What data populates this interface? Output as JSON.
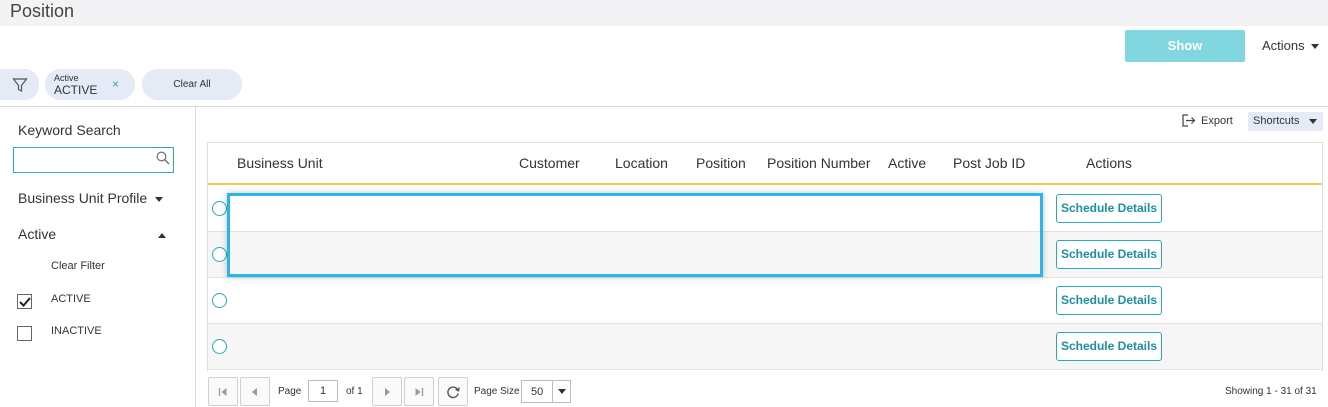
{
  "page": {
    "title": "Position"
  },
  "header": {
    "show_label": "Show",
    "actions_label": "Actions"
  },
  "filters": {
    "chip_label": "Active",
    "chip_value": "ACTIVE",
    "chip_remove": "×",
    "clear_all": "Clear All"
  },
  "sidebar": {
    "keyword_label": "Keyword Search",
    "keyword_value": "",
    "bu_profile_label": "Business Unit Profile",
    "active_label": "Active",
    "clear_filter": "Clear Filter",
    "options": [
      {
        "label": "ACTIVE",
        "checked": true
      },
      {
        "label": "INACTIVE",
        "checked": false
      }
    ]
  },
  "toolbar": {
    "export_label": "Export",
    "shortcuts_label": "Shortcuts"
  },
  "grid": {
    "columns": [
      "Business Unit",
      "Customer",
      "Location",
      "Position",
      "Position Number",
      "Active",
      "Post Job ID",
      "Actions"
    ],
    "rows": [
      {
        "bu": "",
        "customer": "",
        "location": "",
        "position": "",
        "number": "",
        "active": "",
        "job_id": "",
        "action": "Schedule Details"
      },
      {
        "bu": "",
        "customer": "",
        "location": "",
        "position": "",
        "number": "",
        "active": "",
        "job_id": "",
        "action": "Schedule Details"
      },
      {
        "bu": "",
        "customer": "",
        "location": "",
        "position": "",
        "number": "",
        "active": "",
        "job_id": "",
        "action": "Schedule Details"
      },
      {
        "bu": "",
        "customer": "",
        "location": "",
        "position": "",
        "number": "",
        "active": "",
        "job_id": "",
        "action": "Schedule Details"
      }
    ]
  },
  "pager": {
    "page_label": "Page",
    "page_value": "1",
    "of_label": "of 1",
    "page_size_label": "Page Size",
    "page_size_value": "50",
    "showing": "Showing 1 - 31 of 31"
  },
  "colors": {
    "accent": "#2aa7b8",
    "show_button": "#82d6e0",
    "header_underline": "#f5c94c",
    "highlight": "#29b6e6",
    "chip_bg": "#e4eaf6"
  },
  "icons": [
    "filter-icon",
    "close-icon",
    "search-icon",
    "chevron-down-icon",
    "chevron-up-icon",
    "export-icon",
    "first-page-icon",
    "prev-page-icon",
    "next-page-icon",
    "last-page-icon",
    "refresh-icon"
  ]
}
